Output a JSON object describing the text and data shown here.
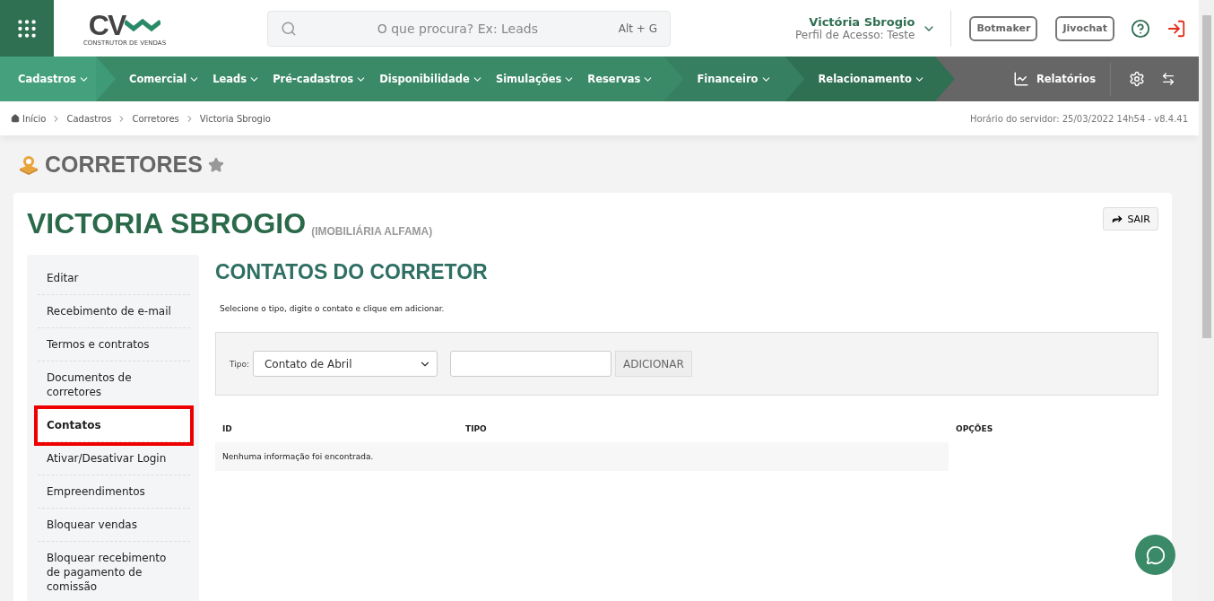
{
  "header": {
    "logo": {
      "letters": "CV",
      "tagline": "CONSTRUTOR DE VENDAS"
    },
    "search": {
      "placeholder": "O que procura? Ex: Leads",
      "shortcut": "Alt + G"
    },
    "user": {
      "name": "Victória Sbrogio",
      "profile": "Perfil de Acesso: Teste"
    },
    "buttons": [
      "Botmaker",
      "Jivochat"
    ]
  },
  "nav": {
    "groups": [
      {
        "items": [
          {
            "label": "Cadastros",
            "selected": true
          }
        ]
      },
      {
        "items": [
          {
            "label": "Comercial",
            "selected": false
          },
          {
            "label": "Leads",
            "selected": false
          },
          {
            "label": "Pré-cadastros",
            "selected": false
          },
          {
            "label": "Disponibilidade",
            "selected": false
          },
          {
            "label": "Simulações",
            "selected": false
          },
          {
            "label": "Reservas",
            "selected": false
          }
        ]
      },
      {
        "items": [
          {
            "label": "Financeiro",
            "selected": false
          }
        ]
      },
      {
        "items": [
          {
            "label": "Relacionamento",
            "selected": false
          }
        ]
      }
    ],
    "reports": "Relatórios"
  },
  "breadcrumb": [
    "Início",
    "Cadastros",
    "Corretores",
    "Victoria Sbrogio"
  ],
  "server_time": "Horário do servidor: 25/03/2022 14h54 - v8.4.41",
  "page_title": "CORRETORES",
  "record": {
    "name": "VICTORIA SBROGIO",
    "company": "(IMOBILIÁRIA ALFAMA)",
    "exit_button": "SAIR"
  },
  "sidebar": {
    "items": [
      {
        "label": "Editar",
        "selected": false
      },
      {
        "label": "Recebimento de e-mail",
        "selected": false
      },
      {
        "label": "Termos e contratos",
        "selected": false
      },
      {
        "label": "Documentos de corretores",
        "selected": false
      },
      {
        "label": "Contatos",
        "selected": true
      },
      {
        "label": "Ativar/Desativar Login",
        "selected": false
      },
      {
        "label": "Empreendimentos",
        "selected": false
      },
      {
        "label": "Bloquear vendas",
        "selected": false
      },
      {
        "label": "Bloquear recebimento de pagamento de comissão",
        "selected": false
      }
    ]
  },
  "section": {
    "title": "CONTATOS DO CORRETOR",
    "hint": "Selecione o tipo, digite o contato e clique em adicionar.",
    "form": {
      "type_label": "Tipo:",
      "type_value": "Contato de Abril",
      "add_button": "ADICIONAR"
    },
    "table": {
      "columns": [
        "ID",
        "TIPO",
        "OPÇÕES"
      ],
      "empty": "Nenhuma informação foi encontrada."
    }
  }
}
